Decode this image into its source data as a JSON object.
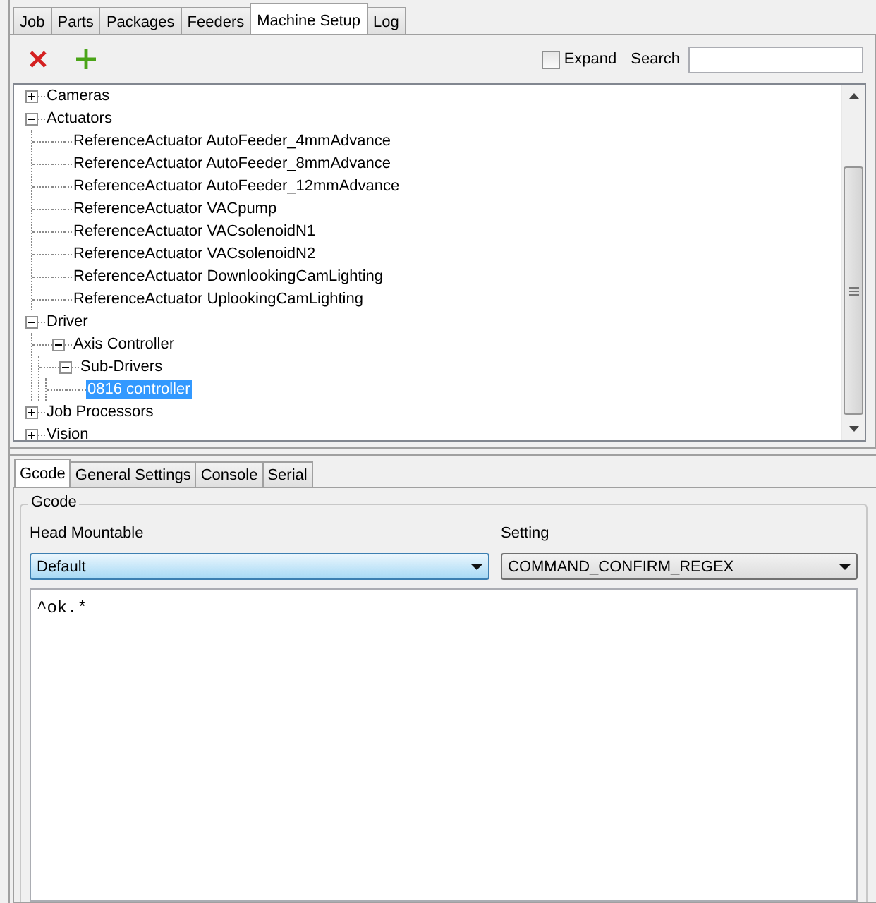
{
  "tabs": [
    {
      "label": "Job",
      "selected": false
    },
    {
      "label": "Parts",
      "selected": false
    },
    {
      "label": "Packages",
      "selected": false
    },
    {
      "label": "Feeders",
      "selected": false
    },
    {
      "label": "Machine Setup",
      "selected": true
    },
    {
      "label": "Log",
      "selected": false
    }
  ],
  "toolbar": {
    "expand": {
      "label": "Expand",
      "checked": false
    },
    "search": {
      "label": "Search"
    }
  },
  "tree": [
    {
      "label": "Cameras",
      "expanded": false,
      "selected": false
    },
    {
      "label": "Actuators",
      "expanded": true,
      "selected": false,
      "children": [
        {
          "label": "ReferenceActuator AutoFeeder_4mmAdvance",
          "selected": false
        },
        {
          "label": "ReferenceActuator AutoFeeder_8mmAdvance",
          "selected": false
        },
        {
          "label": "ReferenceActuator AutoFeeder_12mmAdvance",
          "selected": false
        },
        {
          "label": "ReferenceActuator VACpump",
          "selected": false
        },
        {
          "label": "ReferenceActuator VACsolenoidN1",
          "selected": false
        },
        {
          "label": "ReferenceActuator VACsolenoidN2",
          "selected": false
        },
        {
          "label": "ReferenceActuator DownlookingCamLighting",
          "selected": false
        },
        {
          "label": "ReferenceActuator UplookingCamLighting",
          "selected": false
        }
      ]
    },
    {
      "label": "Driver",
      "expanded": true,
      "selected": false,
      "children": [
        {
          "label": "Axis Controller",
          "expanded": true,
          "selected": false,
          "children": [
            {
              "label": "Sub-Drivers",
              "expanded": true,
              "selected": false,
              "children": [
                {
                  "label": "0816 controller",
                  "selected": true
                }
              ]
            }
          ]
        }
      ]
    },
    {
      "label": "Job Processors",
      "expanded": false,
      "selected": false
    },
    {
      "label": "Vision",
      "expanded": false,
      "selected": false
    }
  ],
  "detail_tabs": [
    {
      "label": "Gcode",
      "selected": true
    },
    {
      "label": "General Settings",
      "selected": false
    },
    {
      "label": "Console",
      "selected": false
    },
    {
      "label": "Serial",
      "selected": false
    }
  ],
  "gcode": {
    "group_title": "Gcode",
    "head_label": "Head Mountable",
    "head_value": "Default",
    "setting_label": "Setting",
    "setting_value": "COMMAND_CONFIRM_REGEX",
    "code": "^ok.*"
  }
}
